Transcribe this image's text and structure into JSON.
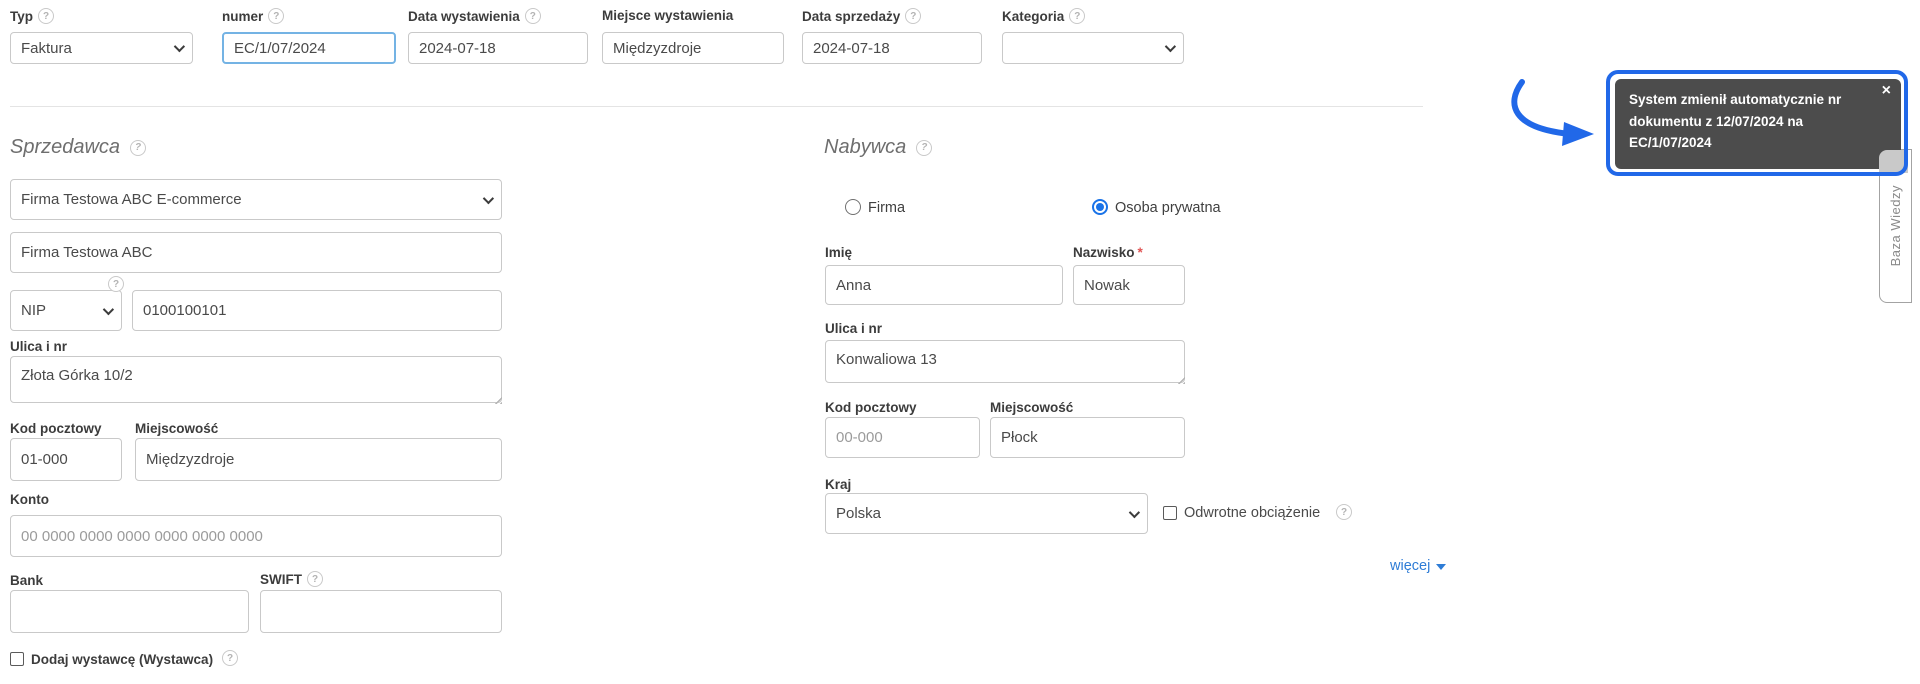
{
  "help_icon": "?",
  "colors": {
    "accent_blue": "#2168e8",
    "link_blue": "#2e7cd6",
    "tooltip_bg": "#4c4c4c",
    "focus_border": "#74b3e4",
    "required_red": "#e05252",
    "radio_selected": "#1a73e8"
  },
  "top_row": {
    "fields": [
      {
        "label": "Typ",
        "value": "Faktura",
        "has_help": true
      },
      {
        "label": "numer",
        "value": "EC/1/07/2024",
        "has_help": true
      },
      {
        "label": "Data wystawienia",
        "value": "2024-07-18",
        "has_help": true
      },
      {
        "label": "Miejsce wystawienia",
        "value": "Międzyzdroje",
        "has_help": false
      },
      {
        "label": "Data sprzedaży",
        "value": "2024-07-18",
        "has_help": true
      },
      {
        "label": "Kategoria",
        "value": "",
        "has_help": true
      }
    ]
  },
  "seller": {
    "heading": "Sprzedawca",
    "company_select_value": "Firma Testowa ABC E-commerce",
    "company_name_value": "Firma Testowa ABC",
    "tax_id_type": "NIP",
    "tax_id_value": "0100100101",
    "street_label": "Ulica i nr",
    "street_value": "Złota Górka 10/2",
    "postal_label": "Kod pocztowy",
    "postal_value": "01-000",
    "city_label": "Miejscowość",
    "city_value": "Międzyzdroje",
    "account_label": "Konto",
    "account_placeholder": "00 0000 0000 0000 0000 0000 0000",
    "bank_label": "Bank",
    "bank_value": "",
    "swift_label": "SWIFT",
    "swift_value": "",
    "issuer_checkbox_label": "Dodaj wystawcę (Wystawca)"
  },
  "buyer": {
    "heading": "Nabywca",
    "type_options": [
      {
        "label": "Firma",
        "selected": false
      },
      {
        "label": "Osoba prywatna",
        "selected": true
      }
    ],
    "first_name_label": "Imię",
    "first_name_value": "Anna",
    "last_name_label": "Nazwisko",
    "required_mark": "*",
    "last_name_value": "Nowak",
    "street_label": "Ulica i nr",
    "street_value": "Konwaliowa 13",
    "postal_label": "Kod pocztowy",
    "postal_placeholder": "00-000",
    "city_label": "Miejscowość",
    "city_value": "Płock",
    "country_label": "Kraj",
    "country_value": "Polska",
    "reverse_charge_label": "Odwrotne obciążenie",
    "more_link": "więcej"
  },
  "tooltip": {
    "text": "System zmienił automatycznie nr dokumentu z 12/07/2024 na EC/1/07/2024",
    "close": "×"
  },
  "knowledge_tab": {
    "label": "Baza Wiedzy"
  }
}
